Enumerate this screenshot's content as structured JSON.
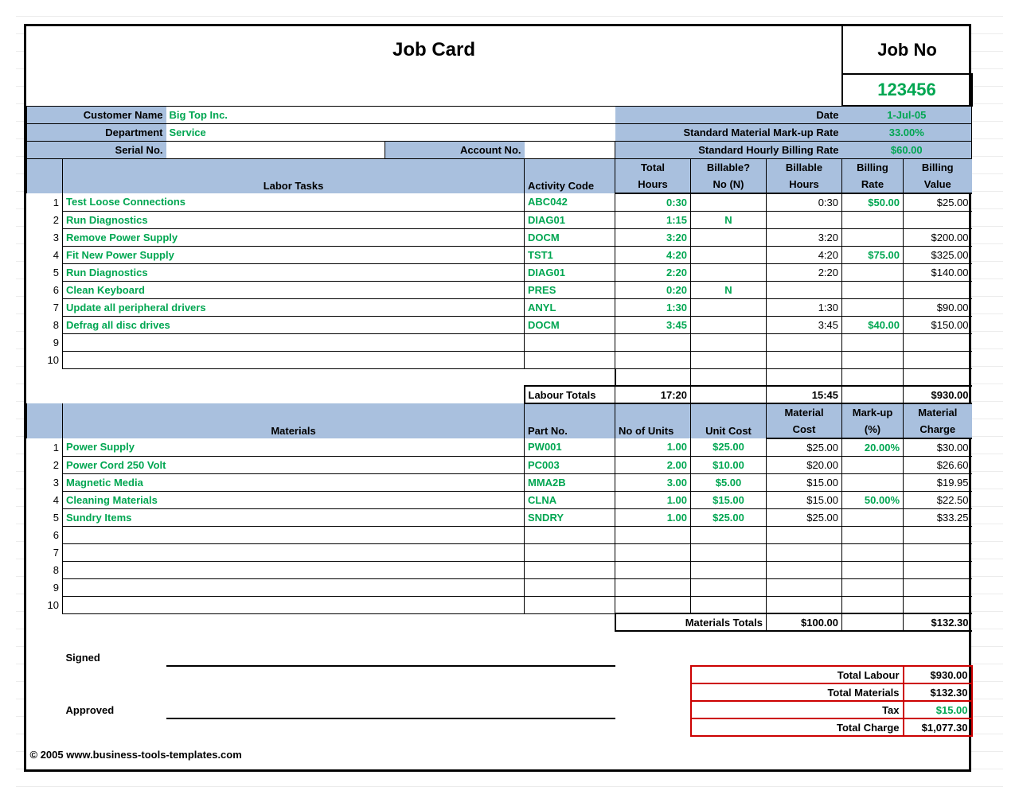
{
  "title": "Job Card",
  "jobno_label": "Job No",
  "jobno_value": "123456",
  "labels": {
    "customer_name": "Customer Name",
    "department": "Department",
    "serial_no": "Serial No.",
    "account_no": "Account No.",
    "date": "Date",
    "std_markup": "Standard Material Mark-up Rate",
    "std_hourly": "Standard Hourly Billing Rate",
    "labor_tasks": "Labor Tasks",
    "activity_code": "Activity Code",
    "total_hours": "Total Hours",
    "billable_no": "Billable? No (N)",
    "billable_hours": "Billable Hours",
    "billing_rate": "Billing Rate",
    "billing_value": "Billing Value",
    "labour_totals": "Labour Totals",
    "materials": "Materials",
    "part_no": "Part No.",
    "no_units": "No of Units",
    "unit_cost": "Unit Cost",
    "material_cost": "Material Cost",
    "markup_pct": "Mark-up (%)",
    "material_charge": "Material Charge",
    "materials_totals": "Materials Totals",
    "signed": "Signed",
    "approved": "Approved",
    "total_labour": "Total Labour",
    "total_materials": "Total Materials",
    "tax": "Tax",
    "total_charge": "Total Charge"
  },
  "header": {
    "customer_name": "Big Top Inc.",
    "department": "Service",
    "serial_no": "",
    "account_no": "",
    "date": "1-Jul-05",
    "std_markup": "33.00%",
    "std_hourly": "$60.00"
  },
  "labor_rows": [
    {
      "n": "1",
      "task": "Test Loose Connections",
      "code": "ABC042",
      "th": "0:30",
      "bn": "",
      "bh": "0:30",
      "rate": "$50.00",
      "val": "$25.00"
    },
    {
      "n": "2",
      "task": "Run Diagnostics",
      "code": "DIAG01",
      "th": "1:15",
      "bn": "N",
      "bh": "",
      "rate": "",
      "val": ""
    },
    {
      "n": "3",
      "task": "Remove Power Supply",
      "code": "DOCM",
      "th": "3:20",
      "bn": "",
      "bh": "3:20",
      "rate": "",
      "val": "$200.00"
    },
    {
      "n": "4",
      "task": "Fit New Power Supply",
      "code": "TST1",
      "th": "4:20",
      "bn": "",
      "bh": "4:20",
      "rate": "$75.00",
      "val": "$325.00"
    },
    {
      "n": "5",
      "task": "Run Diagnostics",
      "code": "DIAG01",
      "th": "2:20",
      "bn": "",
      "bh": "2:20",
      "rate": "",
      "val": "$140.00"
    },
    {
      "n": "6",
      "task": "Clean Keyboard",
      "code": "PRES",
      "th": "0:20",
      "bn": "N",
      "bh": "",
      "rate": "",
      "val": ""
    },
    {
      "n": "7",
      "task": "Update all peripheral drivers",
      "code": "ANYL",
      "th": "1:30",
      "bn": "",
      "bh": "1:30",
      "rate": "",
      "val": "$90.00"
    },
    {
      "n": "8",
      "task": "Defrag all disc drives",
      "code": "DOCM",
      "th": "3:45",
      "bn": "",
      "bh": "3:45",
      "rate": "$40.00",
      "val": "$150.00"
    },
    {
      "n": "9",
      "task": "",
      "code": "",
      "th": "",
      "bn": "",
      "bh": "",
      "rate": "",
      "val": ""
    },
    {
      "n": "10",
      "task": "",
      "code": "",
      "th": "",
      "bn": "",
      "bh": "",
      "rate": "",
      "val": ""
    }
  ],
  "labour_totals": {
    "th": "17:20",
    "bh": "15:45",
    "val": "$930.00"
  },
  "material_rows": [
    {
      "n": "1",
      "mat": "Power Supply",
      "part": "PW001",
      "units": "1.00",
      "cost": "$25.00",
      "mcost": "$25.00",
      "mu": "20.00%",
      "charge": "$30.00"
    },
    {
      "n": "2",
      "mat": "Power Cord 250 Volt",
      "part": "PC003",
      "units": "2.00",
      "cost": "$10.00",
      "mcost": "$20.00",
      "mu": "",
      "charge": "$26.60"
    },
    {
      "n": "3",
      "mat": "Magnetic Media",
      "part": "MMA2B",
      "units": "3.00",
      "cost": "$5.00",
      "mcost": "$15.00",
      "mu": "",
      "charge": "$19.95"
    },
    {
      "n": "4",
      "mat": "Cleaning Materials",
      "part": "CLNA",
      "units": "1.00",
      "cost": "$15.00",
      "mcost": "$15.00",
      "mu": "50.00%",
      "charge": "$22.50"
    },
    {
      "n": "5",
      "mat": "Sundry Items",
      "part": "SNDRY",
      "units": "1.00",
      "cost": "$25.00",
      "mcost": "$25.00",
      "mu": "",
      "charge": "$33.25"
    },
    {
      "n": "6",
      "mat": "",
      "part": "",
      "units": "",
      "cost": "",
      "mcost": "",
      "mu": "",
      "charge": ""
    },
    {
      "n": "7",
      "mat": "",
      "part": "",
      "units": "",
      "cost": "",
      "mcost": "",
      "mu": "",
      "charge": ""
    },
    {
      "n": "8",
      "mat": "",
      "part": "",
      "units": "",
      "cost": "",
      "mcost": "",
      "mu": "",
      "charge": ""
    },
    {
      "n": "9",
      "mat": "",
      "part": "",
      "units": "",
      "cost": "",
      "mcost": "",
      "mu": "",
      "charge": ""
    },
    {
      "n": "10",
      "mat": "",
      "part": "",
      "units": "",
      "cost": "",
      "mcost": "",
      "mu": "",
      "charge": ""
    }
  ],
  "materials_totals": {
    "mcost": "$100.00",
    "charge": "$132.30"
  },
  "totals": {
    "total_labour": "$930.00",
    "total_materials": "$132.30",
    "tax": "$15.00",
    "total_charge": "$1,077.30"
  },
  "copyright": "© 2005 www.business-tools-templates.com"
}
